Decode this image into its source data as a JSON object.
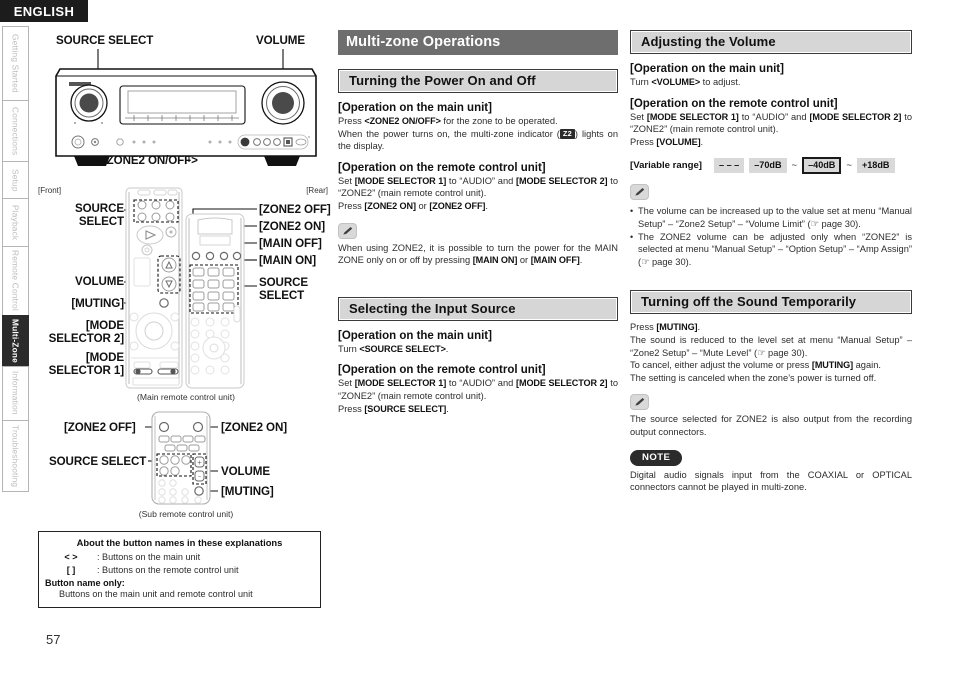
{
  "language_tag": "ENGLISH",
  "page_number": "57",
  "side_tabs": [
    {
      "label": "Getting Started",
      "active": false
    },
    {
      "label": "Connections",
      "active": false
    },
    {
      "label": "Setup",
      "active": false
    },
    {
      "label": "Playback",
      "active": false
    },
    {
      "label": "Remote Control",
      "active": false
    },
    {
      "label": "Multi-Zone",
      "active": true
    },
    {
      "label": "Information",
      "active": false
    },
    {
      "label": "Troubleshooting",
      "active": false
    }
  ],
  "diagrams": {
    "front_unit": {
      "label_source_select": "SOURCE SELECT",
      "label_volume": "VOLUME",
      "label_zone2_onoff": "<ZONE2 ON/OFF>"
    },
    "main_remote": {
      "tag_front": "[Front]",
      "tag_rear": "[Rear]",
      "label_source_select_left": "SOURCE\nSELECT",
      "label_source_select_left_l1": "SOURCE",
      "label_source_select_left_l2": "SELECT",
      "label_volume": "VOLUME",
      "label_muting": "[MUTING]",
      "label_mode_selector_2_l1": "[MODE",
      "label_mode_selector_2_l2": "SELECTOR 2]",
      "label_mode_selector_1_l1": "[MODE",
      "label_mode_selector_1_l2": "SELECTOR 1]",
      "label_zone2_off": "[ZONE2 OFF]",
      "label_zone2_on": "[ZONE2 ON]",
      "label_main_off": "[MAIN OFF]",
      "label_main_on": "[MAIN ON]",
      "label_source_select_right_l1": "SOURCE",
      "label_source_select_right_l2": "SELECT",
      "caption": "(Main remote control unit)"
    },
    "sub_remote": {
      "label_zone2_off": "[ZONE2 OFF]",
      "label_zone2_on": "[ZONE2 ON]",
      "label_source_select": "SOURCE SELECT",
      "label_volume": "VOLUME",
      "label_muting": "[MUTING]",
      "caption": "(Sub remote control unit)"
    }
  },
  "legend": {
    "title": "About the button names in these explanations",
    "rows": [
      {
        "symbol": "<    >",
        "text": ": Buttons on the main unit"
      },
      {
        "symbol": "[    ]",
        "text": ": Buttons on the remote control unit"
      }
    ],
    "subtitle": "Button name only:",
    "last_line": "Buttons on the main unit and remote control unit"
  },
  "chapter_title": "Multi-zone Operations",
  "sections": {
    "power": {
      "heading": "Turning the Power On and Off",
      "main_unit_heading": "[Operation on the main unit]",
      "main_unit_l1_pre": "Press ",
      "main_unit_l1_b": "<ZONE2 ON/OFF>",
      "main_unit_l1_post": " for the zone to be operated.",
      "main_unit_l2_pre": "When the power turns on, the multi-zone indicator (",
      "main_unit_badge": "Z2",
      "main_unit_l2_post": ") lights on the display.",
      "remote_heading": "[Operation on the remote control unit]",
      "remote_l1_a": "Set ",
      "remote_l1_b1": "[MODE SELECTOR 1]",
      "remote_l1_c": " to “AUDIO” and ",
      "remote_l1_b2": "[MODE SELECTOR 2]",
      "remote_l1_d": " to “ZONE2” (main remote control unit).",
      "remote_l2_a": "Press ",
      "remote_l2_b1": "[ZONE2 ON]",
      "remote_l2_c": " or ",
      "remote_l2_b2": "[ZONE2 OFF]",
      "remote_l2_d": ".",
      "memo_a": "When using ZONE2, it is possible to turn the power for the MAIN ZONE only on or off by pressing ",
      "memo_b1": "[MAIN ON]",
      "memo_c": " or ",
      "memo_b2": "[MAIN OFF]",
      "memo_d": "."
    },
    "input_source": {
      "heading": "Selecting the Input Source",
      "main_unit_heading": "[Operation on the main unit]",
      "main_unit_l1_pre": "Turn ",
      "main_unit_l1_b": "<SOURCE SELECT>",
      "main_unit_l1_post": ".",
      "remote_heading": "[Operation on the remote control unit]",
      "remote_l1_a": "Set ",
      "remote_l1_b1": "[MODE SELECTOR 1]",
      "remote_l1_c": " to “AUDIO” and ",
      "remote_l1_b2": "[MODE SELECTOR 2]",
      "remote_l1_d": " to “ZONE2” (main remote control unit).",
      "remote_l2_a": "Press ",
      "remote_l2_b1": "[SOURCE SELECT]",
      "remote_l2_d": "."
    },
    "volume": {
      "heading": "Adjusting the Volume",
      "main_unit_heading": "[Operation on the main unit]",
      "main_unit_l1_pre": "Turn ",
      "main_unit_l1_b": "<VOLUME>",
      "main_unit_l1_post": " to adjust.",
      "remote_heading": "[Operation on the remote control unit]",
      "remote_l1_a": "Set ",
      "remote_l1_b1": "[MODE SELECTOR 1]",
      "remote_l1_c": " to “AUDIO” and ",
      "remote_l1_b2": "[MODE SELECTOR 2]",
      "remote_l1_d": " to “ZONE2” (main remote control unit).",
      "remote_l2_a": "Press ",
      "remote_l2_b1": "[VOLUME]",
      "remote_l2_d": ".",
      "variable_range_label": "[Variable range]",
      "variable_range_items": [
        {
          "text": "– – –",
          "selected": false
        },
        {
          "text": "–70dB",
          "selected": false
        },
        {
          "text": "–40dB",
          "selected": true
        },
        {
          "text": "+18dB",
          "selected": false
        }
      ],
      "tilde": "~",
      "memo_bullets": [
        "The volume can be increased up to the value set at menu “Manual Setup” – “Zone2 Setup” – “Volume Limit” (☞ page 30).",
        "The ZONE2 volume can be adjusted only when “ZONE2” is selected at menu “Manual Setup” – “Option Setup” – “Amp Assign” (☞ page 30)."
      ]
    },
    "muting": {
      "heading": "Turning off the Sound Temporarily",
      "l1_a": "Press ",
      "l1_b": "[MUTING]",
      "l1_c": ".",
      "l2": "The sound is reduced to the level set at menu “Manual Setup” – “Zone2 Setup” – “Mute Level” (☞ page 30).",
      "l3_a": "To cancel, either adjust the volume or press ",
      "l3_b": "[MUTING]",
      "l3_c": " again.",
      "l4": "The setting is canceled when the zone’s power is turned off.",
      "memo": "The source selected for ZONE2 is also output from the recording output connectors.",
      "note_label": "NOTE",
      "note_text": "Digital audio signals input from the COAXIAL or OPTICAL connectors cannot be played in multi-zone."
    }
  },
  "colors": {
    "chapter_bg": "#6e6e6e",
    "section_bg": "#d6d6d6",
    "active_tab_bg": "#2b2b2b",
    "badge_bg": "#2b2b2b"
  }
}
